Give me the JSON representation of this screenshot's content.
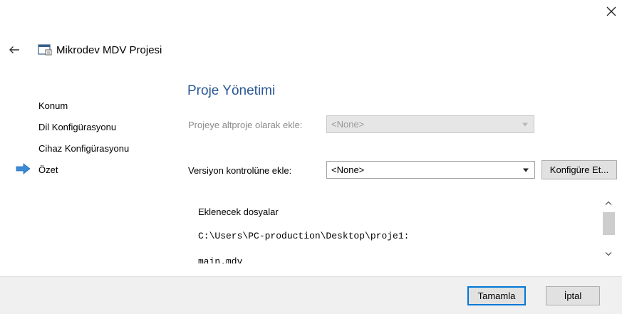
{
  "window": {
    "title": "Mikrodev MDV Projesi"
  },
  "icons": {
    "close": "close-icon",
    "back": "back-arrow-icon",
    "wizard": "project-window-icon",
    "current_step": "current-step-arrow-icon",
    "scroll_up": "chevron-up-icon",
    "scroll_down": "chevron-down-icon"
  },
  "nav": {
    "items": [
      {
        "label": "Konum"
      },
      {
        "label": "Dil Konfigürasyonu"
      },
      {
        "label": "Cihaz Konfigürasyonu"
      },
      {
        "label": "Özet"
      }
    ],
    "active_index": 3
  },
  "main": {
    "section_title": "Proje Yönetimi",
    "subproject": {
      "label": "Projeye altproje olarak ekle:",
      "value": "<None>",
      "enabled": false
    },
    "version_control": {
      "label": "Versiyon kontrolüne ekle:",
      "value": "<None>",
      "enabled": true,
      "configure_label": "Konfigüre Et..."
    },
    "files": {
      "heading": "Eklenecek dosyalar",
      "path": "C:\\Users\\PC-production\\Desktop\\proje1:",
      "cut_line": "main.mdv"
    }
  },
  "footer": {
    "finish_label": "Tamamla",
    "cancel_label": "İptal"
  },
  "colors": {
    "accent": "#0078d7",
    "section_title": "#2b5797",
    "nav_arrow": "#3c8ad6",
    "footer_bg": "#f0f0f0"
  }
}
